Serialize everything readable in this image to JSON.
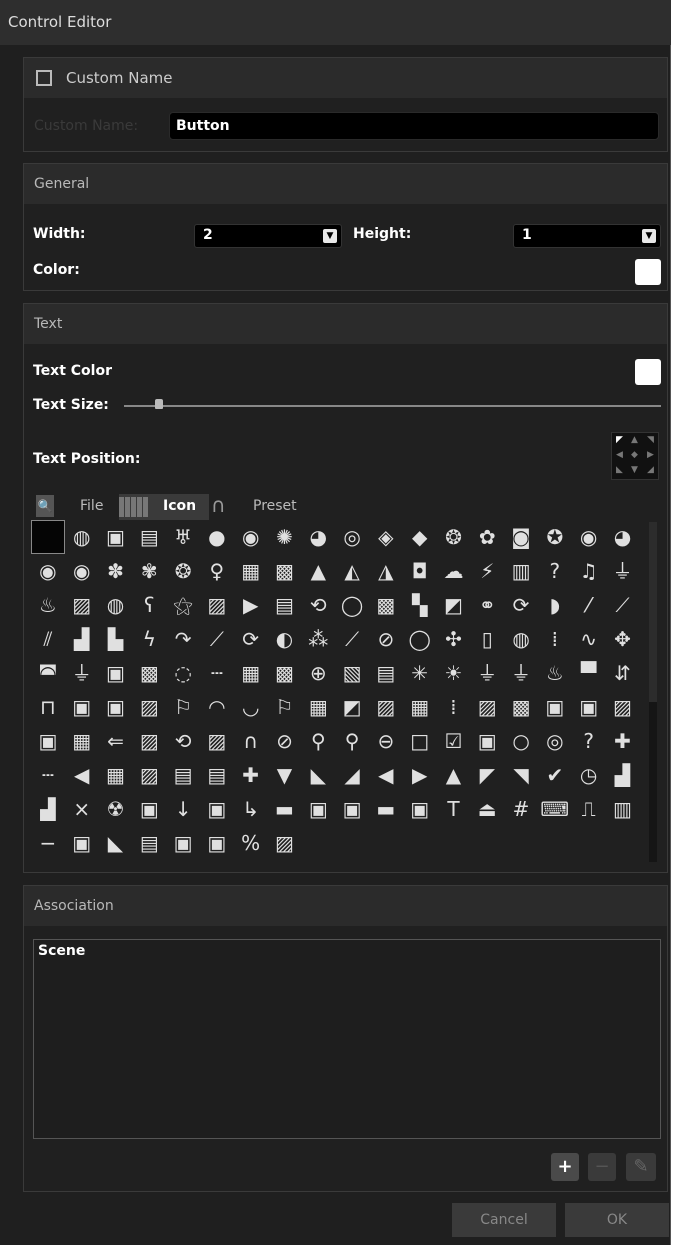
{
  "window": {
    "title": "Control Editor"
  },
  "custom_name": {
    "checkbox_label": "Custom Name",
    "field_label": "Custom Name:",
    "value": "Button"
  },
  "general": {
    "header": "General",
    "width_label": "Width:",
    "width_value": "2",
    "height_label": "Height:",
    "height_value": "1",
    "color_label": "Color:",
    "color_value": "#ffffff"
  },
  "text": {
    "header": "Text",
    "color_label": "Text Color",
    "color_value": "#ffffff",
    "size_label": "Text Size:",
    "size_level": 0.08,
    "position_label": "Text Position:",
    "tabs": [
      "File",
      "Icon",
      "Preset"
    ],
    "active_tab": "Icon",
    "icons": [
      "",
      "◍",
      "▣",
      "▤",
      "♅",
      "●",
      "◉",
      "✺",
      "◕",
      "◎",
      "◈",
      "◆",
      "❂",
      "✿",
      "◙",
      "✪",
      "◉",
      "◕",
      "◉",
      "◉",
      "✽",
      "✾",
      "❂",
      "♀",
      "▦",
      "▩",
      "▲",
      "◭",
      "◮",
      "◘",
      "☁",
      "⚡",
      "▥",
      "?",
      "♫",
      "⏚",
      "♨",
      "▨",
      "◍",
      "ʕ",
      "⚝",
      "▨",
      "▶",
      "▤",
      "⟲",
      "◯",
      "▩",
      "▚",
      "◩",
      "⚭",
      "⟳",
      "◗",
      "⁄",
      "⟋",
      "⫽",
      "▟",
      "▙",
      "ϟ",
      "↷",
      "⟋",
      "⟳",
      "◐",
      "⁂",
      "⟋",
      "⊘",
      "◯",
      "✣",
      "▯",
      "◍",
      "⁞",
      "∿",
      "✥",
      "◚",
      "⏚",
      "▣",
      "▩",
      "◌",
      "┄",
      "▦",
      "▩",
      "⊕",
      "▧",
      "▤",
      "✳",
      "☀",
      "⏚",
      "⏚",
      "♨",
      "▀",
      "⇵",
      "⊓",
      "▣",
      "▣",
      "▨",
      "⚐",
      "◠",
      "◡",
      "⚐",
      "▦",
      "◩",
      "▨",
      "▦",
      "⁞",
      "▨",
      "▩",
      "▣",
      "▣",
      "▨",
      "▣",
      "▦",
      "⇐",
      "▨",
      "⟲",
      "▨",
      "∩",
      "⊘",
      "⚲",
      "⚲",
      "⊖",
      "□",
      "☑",
      "▣",
      "○",
      "◎",
      "?",
      "✚",
      "┄",
      "◀",
      "▦",
      "▨",
      "▤",
      "▤",
      "✚",
      "▼",
      "◣",
      "◢",
      "◀",
      "▶",
      "▲",
      "◤",
      "◥",
      "✔",
      "◷",
      "▟",
      "▟",
      "×",
      "☢",
      "▣",
      "↓",
      "▣",
      "↳",
      "▬",
      "▣",
      "▣",
      "▬",
      "▣",
      "T",
      "⏏",
      "#",
      "⌨",
      "⎍",
      "▥",
      "−",
      "▣",
      "◣",
      "▤",
      "▣",
      "▣",
      "%",
      "▨"
    ]
  },
  "association": {
    "header": "Association",
    "items": [
      "Scene"
    ]
  },
  "buttons": {
    "add": "+",
    "remove": "−",
    "edit": "✎",
    "cancel": "Cancel",
    "ok": "OK"
  }
}
